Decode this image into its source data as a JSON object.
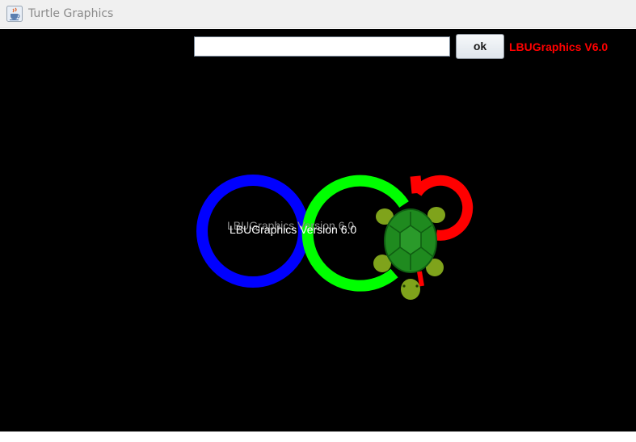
{
  "window": {
    "title": "Turtle Graphics",
    "icon": "java-cup-icon"
  },
  "toolbar": {
    "command_value": "",
    "ok_label": "ok",
    "version_label": "LBUGraphics V6.0",
    "version_color": "#ff0000"
  },
  "canvas": {
    "background": "#000000",
    "ghost_text": "LBUGraphics Version 6.0",
    "text": "LBUGraphics Version 6.0",
    "stroke_colors": [
      "#0000ff",
      "#00ff00",
      "#ff0000"
    ],
    "turtle_icon": "turtle-icon"
  }
}
